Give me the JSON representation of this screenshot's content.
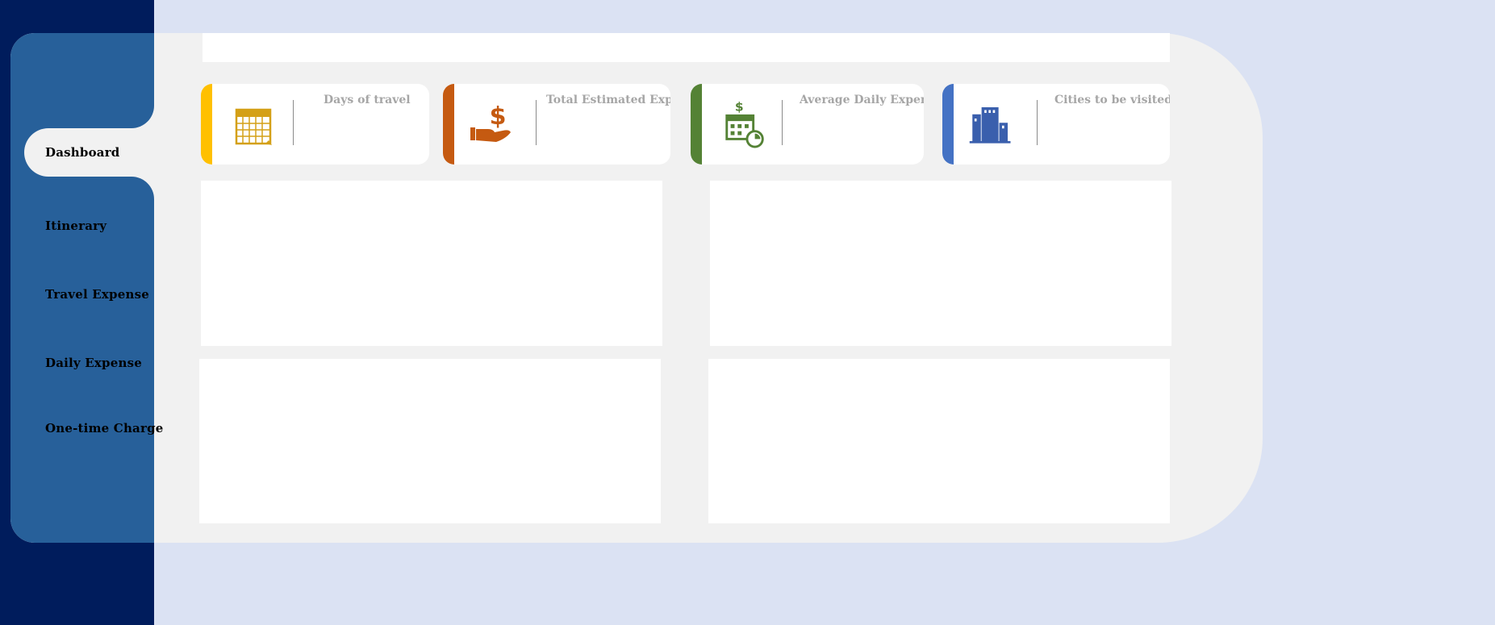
{
  "sidebar": {
    "items": [
      {
        "label": "Dashboard"
      },
      {
        "label": "Itinerary"
      },
      {
        "label": "Travel Expense"
      },
      {
        "label": "Daily Expense"
      },
      {
        "label": "One-time Charge"
      }
    ]
  },
  "kpis": [
    {
      "label": "Days of travel",
      "color": "#ffc000",
      "icon": "calendar-icon"
    },
    {
      "label": "Total Estimated Expense",
      "color": "#c55a11",
      "icon": "hand-dollar-icon"
    },
    {
      "label": "Average Daily Expense",
      "color": "#548235",
      "icon": "calendar-dollar-icon"
    },
    {
      "label": "Cities to be visited",
      "color": "#4472c4",
      "icon": "city-buildings-icon"
    }
  ],
  "colors": {
    "background": "#dbe2f3",
    "navy": "#001c5c",
    "sidebar": "#27609a",
    "panel": "#f1f1f1"
  }
}
